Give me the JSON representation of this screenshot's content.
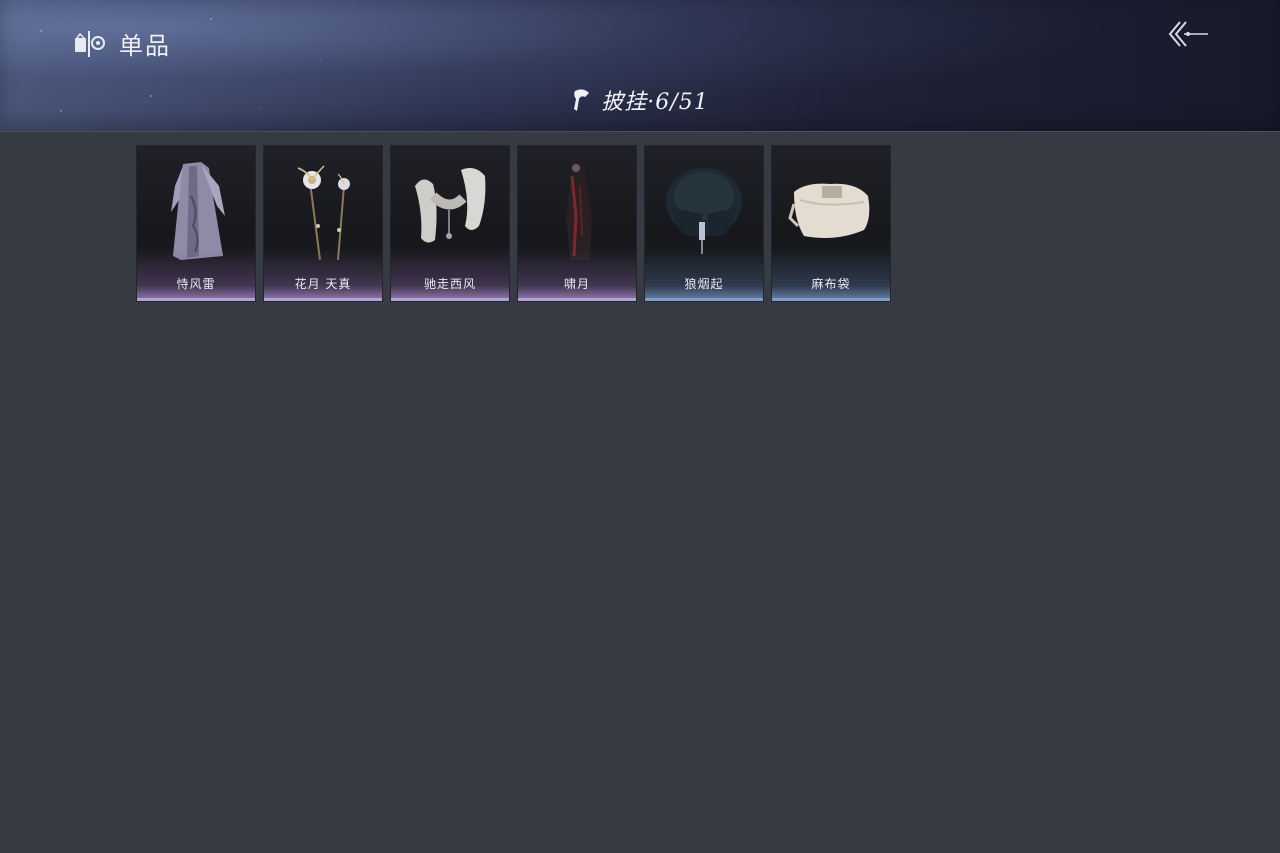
{
  "header": {
    "title": "单品",
    "title_icon": "wardrobe-icon",
    "back_icon": "back-arrow-icon"
  },
  "category": {
    "icon": "cloak-icon",
    "label": "披挂·6/51"
  },
  "items": [
    {
      "name": "恃风雷",
      "rarity_color": "#b4a0d8",
      "icon": "long-robe-icon"
    },
    {
      "name": "花月 天真",
      "rarity_color": "#b4a0d8",
      "icon": "flower-hairpins-icon"
    },
    {
      "name": "驰走西风",
      "rarity_color": "#b4a0d8",
      "icon": "fur-scarf-icon"
    },
    {
      "name": "啸月",
      "rarity_color": "#b4a0d8",
      "icon": "dark-cape-icon"
    },
    {
      "name": "狼烟起",
      "rarity_color": "#7f9cc9",
      "icon": "fur-collar-icon"
    },
    {
      "name": "麻布袋",
      "rarity_color": "#7f9cc9",
      "icon": "cloth-sack-icon"
    }
  ]
}
